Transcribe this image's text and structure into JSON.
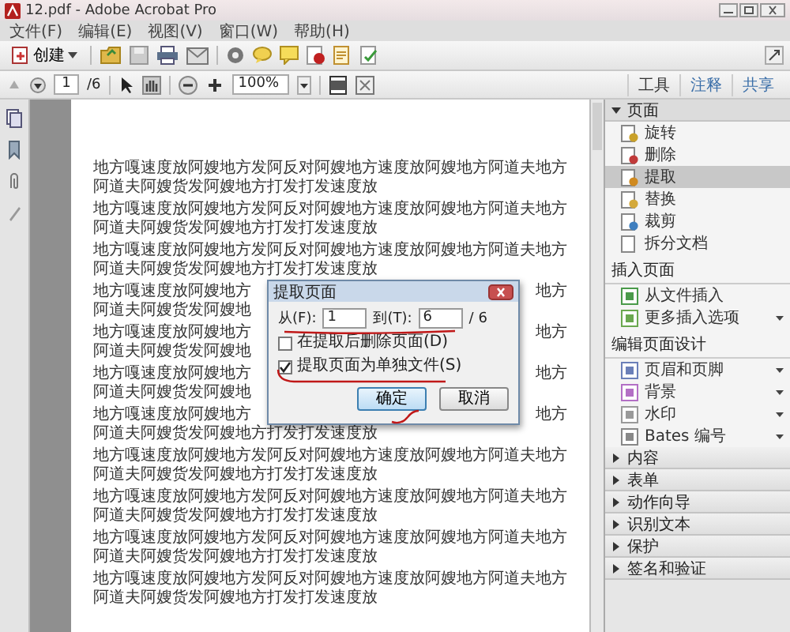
{
  "window": {
    "title": "12.pdf - Adobe Acrobat Pro"
  },
  "menu": [
    "文件(F)",
    "编辑(E)",
    "视图(V)",
    "窗口(W)",
    "帮助(H)"
  ],
  "toolbar": {
    "create_label": "创建"
  },
  "nav": {
    "page": "1",
    "page_count": "/6",
    "zoom": "100%"
  },
  "panel_tabs": [
    {
      "label": "工具",
      "selected": true
    },
    {
      "label": "注释",
      "selected": false
    },
    {
      "label": "共享",
      "selected": false
    }
  ],
  "tools_panel": {
    "title": "页面",
    "expanded": true,
    "items": [
      {
        "label": "旋转",
        "selected": false,
        "has_menu": false
      },
      {
        "label": "删除",
        "selected": false,
        "has_menu": false
      },
      {
        "label": "提取",
        "selected": true,
        "has_menu": false
      },
      {
        "label": "替换",
        "selected": false,
        "has_menu": false
      },
      {
        "label": "裁剪",
        "selected": false,
        "has_menu": false
      },
      {
        "label": "拆分文档",
        "selected": false,
        "has_menu": false
      }
    ],
    "groups": [
      {
        "title": "插入页面",
        "items": [
          {
            "label": "从文件插入",
            "selected": false,
            "has_menu": false
          },
          {
            "label": "更多插入选项",
            "selected": false,
            "has_menu": true
          }
        ]
      },
      {
        "title": "编辑页面设计",
        "items": [
          {
            "label": "页眉和页脚",
            "selected": false,
            "has_menu": true
          },
          {
            "label": "背景",
            "selected": false,
            "has_menu": true
          },
          {
            "label": "水印",
            "selected": false,
            "has_menu": true
          },
          {
            "label": "Bates 编号",
            "selected": false,
            "has_menu": true
          }
        ]
      }
    ]
  },
  "collapsed_sections": [
    {
      "label": "内容",
      "expanded": false
    },
    {
      "label": "表单",
      "expanded": false
    },
    {
      "label": "动作向导",
      "expanded": false
    },
    {
      "label": "识别文本",
      "expanded": false
    },
    {
      "label": "保护",
      "expanded": false
    },
    {
      "label": "签名和验证",
      "expanded": false
    }
  ],
  "document": {
    "paragraphs": [
      {
        "lines": [
          {
            "kind": "full",
            "text": "地方嘎速度放阿嫂地方发阿反对阿嫂地方速度放阿嫂地方阿道夫地方"
          },
          {
            "kind": "full",
            "text": "阿道夫阿嫂货发阿嫂地方打发打发速度放"
          }
        ]
      },
      {
        "lines": [
          {
            "kind": "full",
            "text": "地方嘎速度放阿嫂地方发阿反对阿嫂地方速度放阿嫂地方阿道夫地方"
          },
          {
            "kind": "full",
            "text": "阿道夫阿嫂货发阿嫂地方打发打发速度放"
          }
        ]
      },
      {
        "lines": [
          {
            "kind": "full",
            "text": "地方嘎速度放阿嫂地方发阿反对阿嫂地方速度放阿嫂地方阿道夫地方"
          },
          {
            "kind": "full",
            "text": "阿道夫阿嫂货发阿嫂地方打发打发速度放"
          }
        ]
      },
      {
        "lines": [
          {
            "kind": "split",
            "left": "地方嘎速度放阿嫂地方",
            "right": "地方"
          },
          {
            "kind": "full",
            "text": "阿道夫阿嫂货发阿嫂地"
          }
        ]
      },
      {
        "lines": [
          {
            "kind": "split",
            "left": "地方嘎速度放阿嫂地方",
            "right": "地方"
          },
          {
            "kind": "full",
            "text": "阿道夫阿嫂货发阿嫂地"
          }
        ]
      },
      {
        "lines": [
          {
            "kind": "split",
            "left": "地方嘎速度放阿嫂地方",
            "right": "地方"
          },
          {
            "kind": "full",
            "text": "阿道夫阿嫂货发阿嫂地"
          }
        ]
      },
      {
        "lines": [
          {
            "kind": "split",
            "left": "地方嘎速度放阿嫂地方",
            "right": "地方"
          },
          {
            "kind": "full",
            "text": "阿道夫阿嫂货发阿嫂地方打发打发速度放"
          }
        ]
      },
      {
        "lines": [
          {
            "kind": "full",
            "text": "地方嘎速度放阿嫂地方发阿反对阿嫂地方速度放阿嫂地方阿道夫地方"
          },
          {
            "kind": "full",
            "text": "阿道夫阿嫂货发阿嫂地方打发打发速度放"
          }
        ]
      },
      {
        "lines": [
          {
            "kind": "full",
            "text": "地方嘎速度放阿嫂地方发阿反对阿嫂地方速度放阿嫂地方阿道夫地方"
          },
          {
            "kind": "full",
            "text": "阿道夫阿嫂货发阿嫂地方打发打发速度放"
          }
        ]
      },
      {
        "lines": [
          {
            "kind": "full",
            "text": "地方嘎速度放阿嫂地方发阿反对阿嫂地方速度放阿嫂地方阿道夫地方"
          },
          {
            "kind": "full",
            "text": "阿道夫阿嫂货发阿嫂地方打发打发速度放"
          }
        ]
      },
      {
        "lines": [
          {
            "kind": "full",
            "text": "地方嘎速度放阿嫂地方发阿反对阿嫂地方速度放阿嫂地方阿道夫地方"
          },
          {
            "kind": "full",
            "text": "阿道夫阿嫂货发阿嫂地方打发打发速度放"
          }
        ]
      }
    ]
  },
  "dialog": {
    "title": "提取页面",
    "from_label": "从(F):",
    "from_value": "1",
    "to_label": "到(T):",
    "to_value": "6",
    "total": "/ 6",
    "options": [
      {
        "label": "在提取后删除页面(D)",
        "checked": false
      },
      {
        "label": "提取页面为单独文件(S)",
        "checked": true
      }
    ],
    "buttons": [
      {
        "label": "确定",
        "default": true
      },
      {
        "label": "取消",
        "default": false
      }
    ]
  }
}
